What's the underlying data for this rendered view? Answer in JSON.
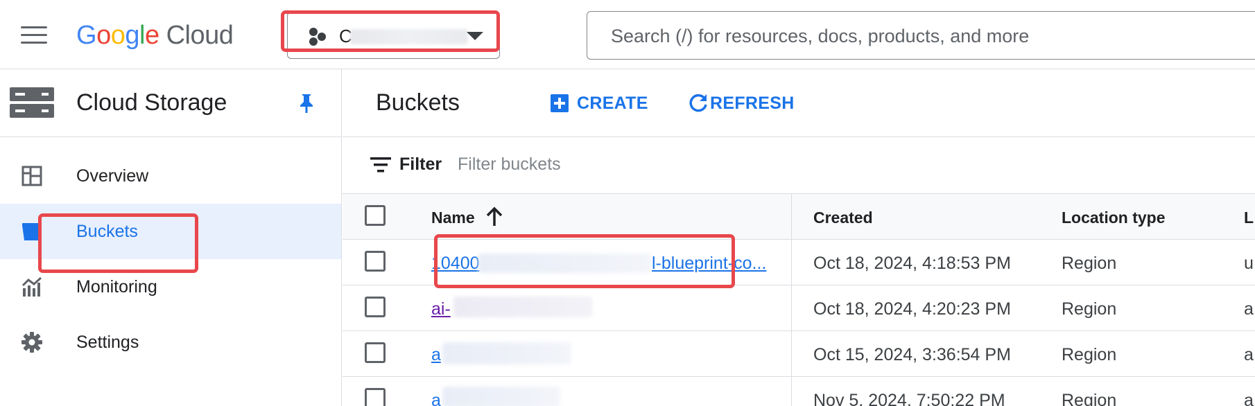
{
  "header": {
    "logo_google": "Google",
    "logo_cloud": "Cloud",
    "project_initial": "C",
    "search_placeholder": "Search (/) for resources, docs, products, and more"
  },
  "sidebar": {
    "title": "Cloud Storage",
    "items": [
      {
        "label": "Overview",
        "icon": "dashboard-icon",
        "active": false
      },
      {
        "label": "Buckets",
        "icon": "bucket-icon",
        "active": true
      },
      {
        "label": "Monitoring",
        "icon": "chart-icon",
        "active": false
      },
      {
        "label": "Settings",
        "icon": "gear-icon",
        "active": false
      }
    ]
  },
  "main": {
    "title": "Buckets",
    "create_label": "CREATE",
    "refresh_label": "REFRESH",
    "filter_label": "Filter",
    "filter_placeholder": "Filter buckets"
  },
  "table": {
    "columns": {
      "name": "Name",
      "created": "Created",
      "location_type": "Location type",
      "location": "L"
    },
    "rows": [
      {
        "name_start": "10400",
        "name_end": "l-blueprint-co...",
        "created": "Oct 18, 2024, 4:18:53 PM",
        "location_type": "Region",
        "location": "u"
      },
      {
        "name_start": "ai-",
        "name_end": "",
        "created": "Oct 18, 2024, 4:20:23 PM",
        "location_type": "Region",
        "location": "a"
      },
      {
        "name_start": "a",
        "name_end": "",
        "created": "Oct 15, 2024, 3:36:54 PM",
        "location_type": "Region",
        "location": "a"
      },
      {
        "name_start": "a",
        "name_end": "",
        "created": "Nov 5, 2024, 7:50:22 PM",
        "location_type": "Region",
        "location": "a"
      }
    ]
  },
  "colors": {
    "accent": "#1a73e8",
    "highlight": "#e8474c",
    "active_bg": "#e8f0fe",
    "visited_link": "#681da8"
  }
}
